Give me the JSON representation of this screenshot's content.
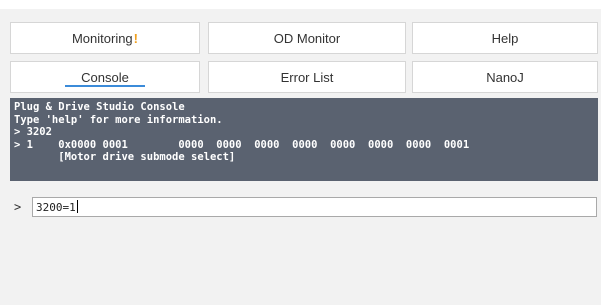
{
  "tabs": {
    "row1": [
      {
        "label": "Monitoring",
        "warning": "!"
      },
      {
        "label": "OD Monitor"
      },
      {
        "label": "Help"
      }
    ],
    "row2": [
      {
        "label": "Console",
        "active": true
      },
      {
        "label": "Error List"
      },
      {
        "label": "NanoJ"
      }
    ]
  },
  "console": {
    "lines": [
      "Plug & Drive Studio Console",
      "Type 'help' for more information.",
      "> 3202",
      "> 1    0x0000 0001        0000  0000  0000  0000  0000  0000  0000  0001",
      "       [Motor drive submode select]"
    ]
  },
  "command": {
    "prompt": ">",
    "value": "3200=1"
  },
  "colors": {
    "console_bg": "#5a6270",
    "accent": "#3b8bd9",
    "warning": "#f0a020"
  }
}
